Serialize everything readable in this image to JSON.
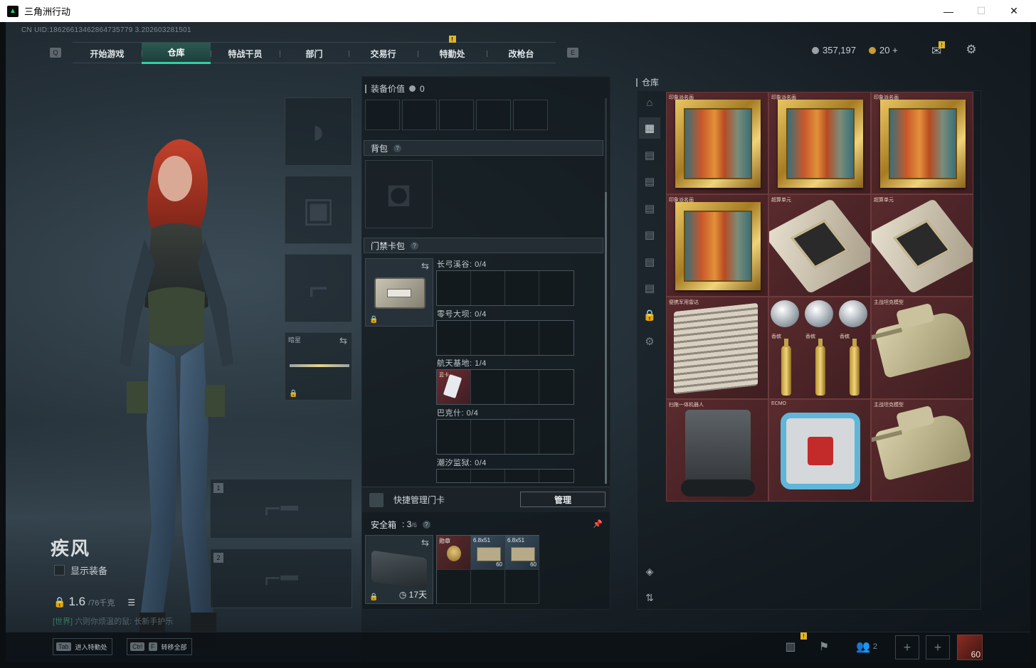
{
  "window": {
    "title": "三角洲行动",
    "minimize": "—",
    "maximize": "☐",
    "close": "✕"
  },
  "uid": "CN UID:18626613462864735779 3.202603281501",
  "nav": {
    "left_key": "Q",
    "right_key": "E",
    "tabs": [
      {
        "label": "开始游戏"
      },
      {
        "label": "仓库",
        "active": true
      },
      {
        "label": "特战干员"
      },
      {
        "label": "部门"
      },
      {
        "label": "交易行"
      },
      {
        "label": "特勤处",
        "badge": "!"
      },
      {
        "label": "改枪台"
      }
    ]
  },
  "currency": {
    "coins": "357,197",
    "tickets": "20",
    "tickets_plus": "+"
  },
  "header_icons": {
    "mail_badge": "!",
    "mail_icon": "mail-icon",
    "settings_icon": "gear-icon"
  },
  "operator": {
    "name": "疾风",
    "show_equipment": "显示装备",
    "weight_value": "1.6",
    "weight_max": "/76千克",
    "chat_channel": "[世界]",
    "chat_text": "六则你烦温的鼠: 长新手护乐"
  },
  "equipment_slots": {
    "melee_label": "暗星",
    "primary_num": "1",
    "secondary_num": "2"
  },
  "center": {
    "equip_value_label": "装备价值",
    "equip_value": "0",
    "backpack": "背包",
    "keycard_bag": "门禁卡包",
    "keycard_rows": [
      {
        "label": "长弓溪谷: 0/4"
      },
      {
        "label": "零号大坝: 0/4"
      },
      {
        "label": "航天基地: 1/4",
        "filled_tag": "蓝卡"
      },
      {
        "label": "巴克什: 0/4"
      },
      {
        "label": "潮汐监狱: 0/4"
      }
    ],
    "quick_manage": "快捷管理门卡",
    "manage_button": "管理",
    "safe_box": "安全箱",
    "safe_capacity": "3",
    "safe_total": "/6",
    "safe_days": "17天",
    "safe_items": [
      {
        "label": "勋章",
        "type": "medal"
      },
      {
        "label": "6.8x51",
        "count": "60",
        "type": "ammo"
      },
      {
        "label": "6.8x51",
        "count": "60",
        "type": "ammo"
      }
    ]
  },
  "stash": {
    "title": "仓库",
    "items": [
      {
        "name": "印象派名画",
        "kind": "painting"
      },
      {
        "name": "印象派名画",
        "kind": "painting"
      },
      {
        "name": "印象派名画",
        "kind": "painting"
      },
      {
        "name": "印象派名画",
        "kind": "painting"
      },
      {
        "name": "超算单元",
        "kind": "gpu"
      },
      {
        "name": "超算单元",
        "kind": "gpu"
      },
      {
        "name": "便携军用雷达",
        "kind": "radar"
      },
      {
        "name": "",
        "kind": "diamonds"
      },
      {
        "name": "主战坦克模型",
        "kind": "tank"
      },
      {
        "name": "扫拖一体机器人",
        "kind": "roomba"
      },
      {
        "name": "ECMO",
        "kind": "ecmo"
      },
      {
        "name": "主战坦克模型",
        "kind": "tank"
      }
    ],
    "champagne_label": "香槟"
  },
  "bottom": {
    "hint1_key": "Tab",
    "hint1_text": "进入特勤处",
    "hint2_key1": "Ctrl",
    "hint2_key2": "F",
    "hint2_text": "转移全部",
    "friends_count": "2",
    "stats_badge": "!",
    "player_level": "60"
  }
}
